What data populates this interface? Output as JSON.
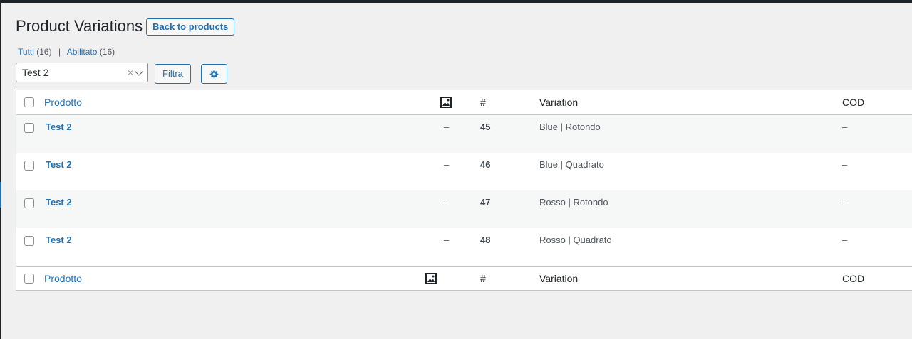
{
  "page": {
    "title": "Product Variations",
    "back_button": "Back to products"
  },
  "views": {
    "all_label": "Tutti",
    "all_count": "(16)",
    "separator": "|",
    "enabled_label": "Abilitato",
    "enabled_count": "(16)"
  },
  "filters": {
    "product_select_value": "Test 2",
    "clear_glyph": "×",
    "filter_button": "Filtra"
  },
  "table": {
    "columns": {
      "name": "Prodotto",
      "hash": "#",
      "variation": "Variation",
      "cod": "COD"
    },
    "rows": [
      {
        "name": "Test 2",
        "image": "–",
        "id": "45",
        "variation": "Blue | Rotondo",
        "cod": "–"
      },
      {
        "name": "Test 2",
        "image": "–",
        "id": "46",
        "variation": "Blue | Quadrato",
        "cod": "–"
      },
      {
        "name": "Test 2",
        "image": "–",
        "id": "47",
        "variation": "Rosso | Rotondo",
        "cod": "–"
      },
      {
        "name": "Test 2",
        "image": "–",
        "id": "48",
        "variation": "Rosso | Quadrato",
        "cod": "–"
      }
    ]
  },
  "icons": {
    "image_column": "image-icon",
    "settings": "gear-icon"
  },
  "colors": {
    "accent": "#2271b1",
    "background": "#f0f0f1",
    "alt_row": "#f6f7f7"
  }
}
